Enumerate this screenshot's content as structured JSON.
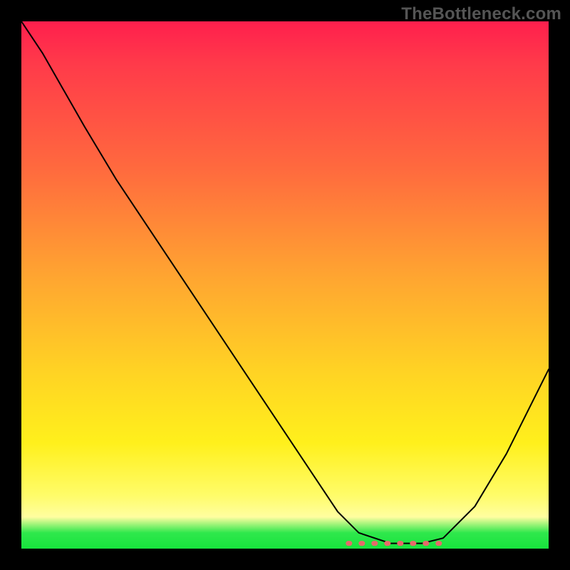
{
  "watermark": "TheBottleneck.com",
  "chart_data": {
    "type": "line",
    "title": "",
    "xlabel": "",
    "ylabel": "",
    "xlim": [
      0,
      100
    ],
    "ylim": [
      0,
      100
    ],
    "grid": false,
    "legend": false,
    "series": [
      {
        "name": "curve",
        "x": [
          0,
          4,
          8,
          12,
          18,
          26,
          34,
          42,
          50,
          56,
          60,
          64,
          70,
          76,
          80,
          86,
          92,
          100
        ],
        "y": [
          100,
          94,
          87,
          80,
          70,
          58,
          46,
          34,
          22,
          13,
          7,
          3,
          1,
          1,
          2,
          8,
          18,
          34
        ]
      }
    ],
    "highlight_range_x": [
      62,
      80
    ],
    "gradient_stops": [
      {
        "pos": 0,
        "color": "#ff1f4d"
      },
      {
        "pos": 8,
        "color": "#ff3a4a"
      },
      {
        "pos": 28,
        "color": "#ff6a3e"
      },
      {
        "pos": 48,
        "color": "#ffa431"
      },
      {
        "pos": 66,
        "color": "#ffd224"
      },
      {
        "pos": 80,
        "color": "#fff01c"
      },
      {
        "pos": 90,
        "color": "#fffc6a"
      },
      {
        "pos": 94,
        "color": "#fffea0"
      },
      {
        "pos": 97,
        "color": "#2fe84c"
      },
      {
        "pos": 100,
        "color": "#17e33d"
      }
    ]
  }
}
